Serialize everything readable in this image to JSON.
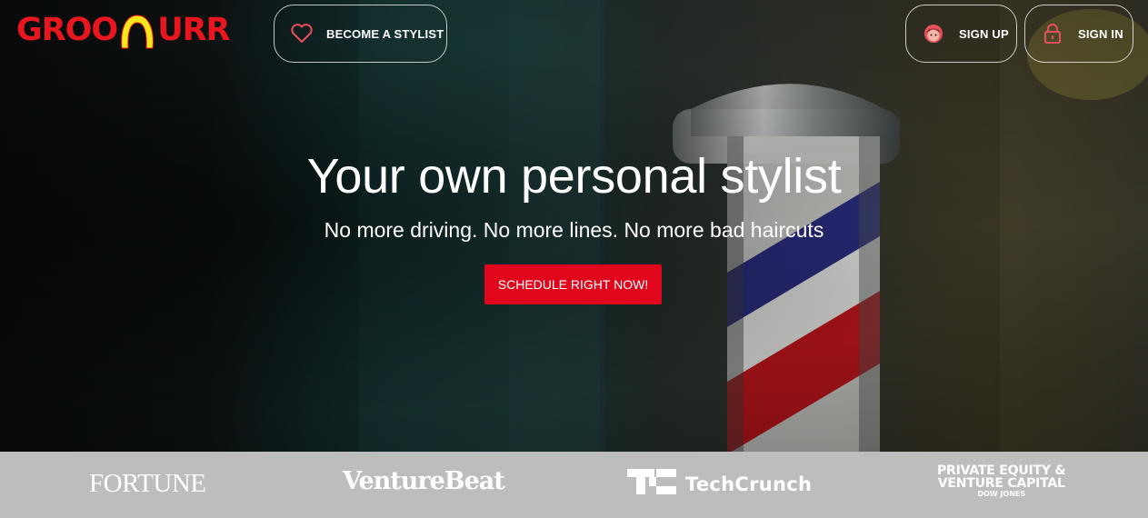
{
  "header": {
    "logo_text": "GROOMURR",
    "become_stylist_label": "BECOME A STYLIST",
    "sign_up_label": "SIGN UP",
    "sign_in_label": "SIGN IN",
    "icons": [
      "heart-icon",
      "face-icon",
      "lock-icon"
    ],
    "icon_color": "#e8505b"
  },
  "hero": {
    "title": "Your own personal stylist",
    "subtitle": "No more driving. No more lines. No more bad haircuts",
    "cta_label": "SCHEDULE RIGHT NOW!",
    "cta_color": "#e0071c"
  },
  "press": {
    "background": "#bdbdbd",
    "logos": {
      "fortune": "FORTUNE",
      "venturebeat": "VentureBeat",
      "techcrunch": "TechCrunch",
      "pe_line1": "PRIVATE EQUITY &",
      "pe_line2": "VENTURE CAPITAL",
      "pe_line3": "DOW JONES"
    }
  },
  "colors": {
    "brand_red": "#e8171f",
    "brand_yellow": "#f5e71c"
  }
}
